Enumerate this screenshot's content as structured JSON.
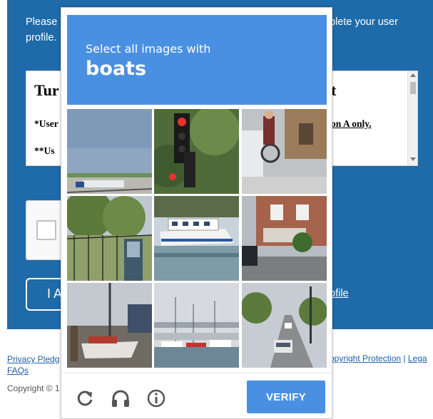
{
  "background_page": {
    "intro_left": "Please profile.",
    "intro_right": "plete your user",
    "textbox": {
      "heading_left": "Tur",
      "heading_right": "t",
      "line1_left": "*User",
      "line1_right": "on A only.",
      "line2_left": "**Us"
    },
    "button_left_fragment": "I A",
    "link_right_fragment": "ofile",
    "footer": {
      "privacy_link": "Privacy Pledg",
      "faqs_link": "FAQs",
      "right_links": [
        "opyright Protection",
        "Lega"
      ],
      "separator": "|",
      "copyright": "Copyright © 1"
    }
  },
  "captcha": {
    "prompt": "Select all images with",
    "target": "boats",
    "tiles": [
      {
        "id": 1,
        "scene": "highway-truck"
      },
      {
        "id": 2,
        "scene": "traffic-light"
      },
      {
        "id": 3,
        "scene": "bicycle-street"
      },
      {
        "id": 4,
        "scene": "fence-trees"
      },
      {
        "id": 5,
        "scene": "ferry-boat"
      },
      {
        "id": 6,
        "scene": "houses-street"
      },
      {
        "id": 7,
        "scene": "boats-dock"
      },
      {
        "id": 8,
        "scene": "harbor-marina"
      },
      {
        "id": 9,
        "scene": "city-street"
      }
    ],
    "footer": {
      "reload_icon": "reload-icon",
      "audio_icon": "headphones-icon",
      "info_icon": "info-icon",
      "verify_label": "VERIFY"
    }
  },
  "colors": {
    "page_blue": "#1f6aa8",
    "captcha_blue": "#4a90e2",
    "link_blue": "#1f5fa8"
  }
}
